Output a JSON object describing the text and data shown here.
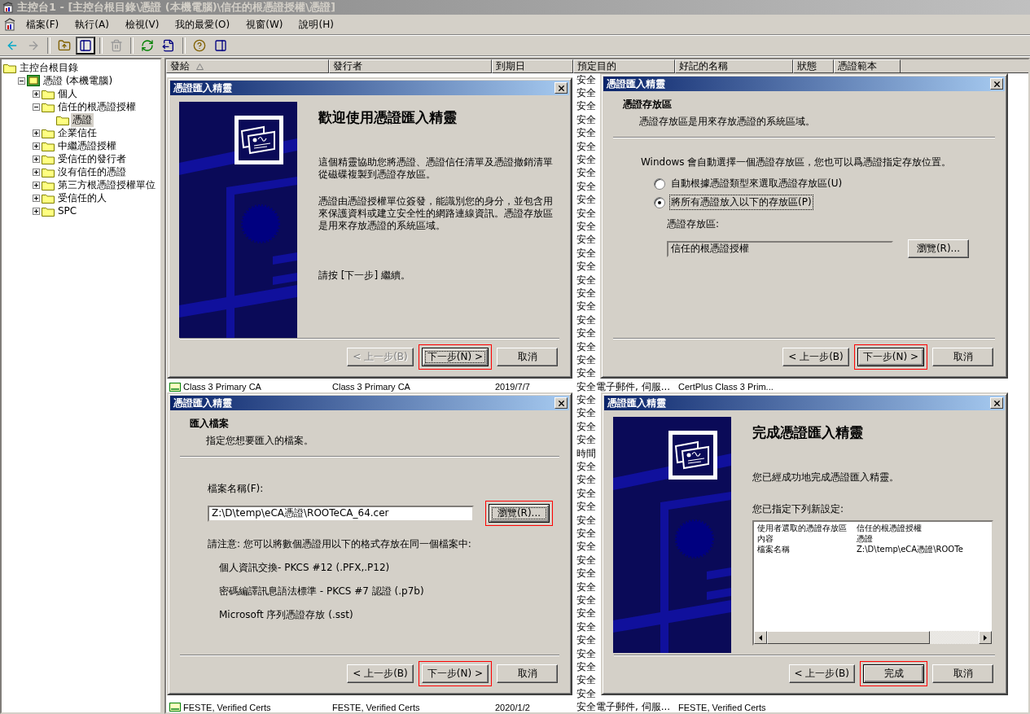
{
  "window": {
    "title": "主控台1 - [主控台根目錄\\憑證 (本機電腦)\\信任的根憑證授權\\憑證]"
  },
  "menu": [
    "檔案(F)",
    "執行(A)",
    "檢視(V)",
    "我的最愛(O)",
    "視窗(W)",
    "說明(H)"
  ],
  "toolbar": [
    {
      "kind": "back",
      "disabled": false
    },
    {
      "kind": "forward",
      "disabled": true
    },
    {
      "kind": "separator"
    },
    {
      "kind": "up",
      "disabled": false
    },
    {
      "kind": "tree",
      "disabled": false,
      "pressed": true
    },
    {
      "kind": "separator"
    },
    {
      "kind": "delete",
      "disabled": true
    },
    {
      "kind": "separator"
    },
    {
      "kind": "refresh",
      "disabled": false
    },
    {
      "kind": "export",
      "disabled": false
    },
    {
      "kind": "separator"
    },
    {
      "kind": "help",
      "disabled": false
    },
    {
      "kind": "panel",
      "disabled": false
    }
  ],
  "tree": {
    "label": "主控台根目錄",
    "kind": "root",
    "selected": false,
    "children": [
      {
        "label": "憑證 (本機電腦)",
        "kind": "store",
        "expanded": true,
        "selected": false,
        "children": [
          {
            "label": "個人",
            "kind": "folder",
            "expanded": false,
            "selected": false
          },
          {
            "label": "信任的根憑證授權",
            "kind": "folder",
            "expanded": true,
            "selected": false,
            "children": [
              {
                "label": "憑證",
                "kind": "folder",
                "selected": true
              }
            ]
          },
          {
            "label": "企業信任",
            "kind": "folder",
            "expanded": false,
            "selected": false
          },
          {
            "label": "中繼憑證授權",
            "kind": "folder",
            "expanded": false,
            "selected": false
          },
          {
            "label": "受信任的發行者",
            "kind": "folder",
            "expanded": false,
            "selected": false
          },
          {
            "label": "沒有信任的憑證",
            "kind": "folder",
            "expanded": false,
            "selected": false
          },
          {
            "label": "第三方根憑證授權單位",
            "kind": "folder",
            "expanded": false,
            "selected": false
          },
          {
            "label": "受信任的人",
            "kind": "folder",
            "expanded": false,
            "selected": false
          },
          {
            "label": "SPC",
            "kind": "folder",
            "expanded": false,
            "selected": false
          }
        ]
      }
    ]
  },
  "list": {
    "columns": [
      {
        "label": "發給",
        "sorted": true
      },
      {
        "label": "發行者",
        "sorted": false
      },
      {
        "label": "到期日",
        "sorted": false
      },
      {
        "label": "預定目的",
        "sorted": false
      },
      {
        "label": "好記的名稱",
        "sorted": false
      },
      {
        "label": "狀態",
        "sorted": false
      },
      {
        "label": "憑證範本",
        "sorted": false
      }
    ],
    "rows": [
      {
        "purpose": "安全"
      },
      {
        "purpose": "安全"
      },
      {
        "purpose": "安全"
      },
      {
        "purpose": "安全"
      },
      {
        "purpose": "安全"
      },
      {
        "purpose": "安全"
      },
      {
        "purpose": "安全"
      },
      {
        "purpose": "安全"
      },
      {
        "purpose": "安全"
      },
      {
        "purpose": "安全"
      },
      {
        "purpose": "安全"
      },
      {
        "purpose": "安全"
      },
      {
        "purpose": "安全"
      },
      {
        "purpose": "安全"
      },
      {
        "purpose": "安全"
      },
      {
        "purpose": "安全"
      },
      {
        "purpose": "安全"
      },
      {
        "purpose": "安全"
      },
      {
        "purpose": "安全"
      },
      {
        "purpose": "安全"
      },
      {
        "purpose": "安全"
      },
      {
        "purpose": "安全"
      },
      {
        "purpose": "安全"
      },
      {
        "issued_to": "Class 3 Primary CA",
        "issuer": "Class 3 Primary CA",
        "expiry": "2019/7/7",
        "purpose": "安全電子郵件, 伺服...",
        "friendly_name": "CertPlus Class 3 Prim..."
      },
      {
        "purpose": "安全"
      },
      {
        "purpose": "安全"
      },
      {
        "purpose": "安全"
      },
      {
        "purpose": "安全"
      },
      {
        "purpose": "時間"
      },
      {
        "purpose": "安全"
      },
      {
        "purpose": "安全"
      },
      {
        "purpose": "安全"
      },
      {
        "purpose": "安全"
      },
      {
        "purpose": "安全"
      },
      {
        "purpose": "安全"
      },
      {
        "purpose": "安全"
      },
      {
        "purpose": "安全"
      },
      {
        "purpose": "安全"
      },
      {
        "purpose": "安全"
      },
      {
        "purpose": "安全"
      },
      {
        "purpose": "安全"
      },
      {
        "purpose": "安全"
      },
      {
        "purpose": "安全"
      },
      {
        "purpose": "安全"
      },
      {
        "purpose": "安全"
      },
      {
        "purpose": "安全"
      },
      {
        "purpose": "安全"
      },
      {
        "issued_to": "FESTE, Verified Certs",
        "issuer": "FESTE, Verified Certs",
        "expiry": "2020/1/2",
        "purpose": "安全電子郵件, 伺服...",
        "friendly_name": "FESTE, Verified Certs"
      }
    ]
  },
  "dialogs": [
    {
      "kind": "welcome",
      "title": "憑證匯入精靈",
      "heading": "歡迎使用憑證匯入精靈",
      "paragraphs": [
        "這個精靈協助您將憑證、憑證信任清單及憑證撤銷清單從磁碟複製到憑證存放區。",
        "憑證由憑證授權單位簽發，能識別您的身分，並包含用來保護資料或建立安全性的網路連線資訊。憑證存放區是用來存放憑證的系統區域。",
        "請按 [下一步] 繼續。"
      ],
      "buttons": [
        {
          "label": "< 上一步(B)",
          "disabled": true,
          "default": false,
          "highlighted": false
        },
        {
          "label": "下一步(N) >",
          "disabled": false,
          "default": true,
          "highlighted": true
        },
        {
          "label": "取消",
          "disabled": false,
          "default": false,
          "highlighted": false
        }
      ]
    },
    {
      "kind": "store",
      "title": "憑證匯入精靈",
      "heading": "憑證存放區",
      "subheading": "憑證存放區是用來存放憑證的系統區域。",
      "intro": "Windows 會自動選擇一個憑證存放區，您也可以爲憑證指定存放位置。",
      "options": [
        {
          "label": "自動根據憑證類型來選取憑證存放區(U)",
          "selected": false,
          "focused": false
        },
        {
          "label": "將所有憑證放入以下的存放區(P)",
          "selected": true,
          "focused": true
        }
      ],
      "field": {
        "label": "憑證存放區:",
        "value": "信任的根憑證授權",
        "disabled": true
      },
      "browse": {
        "label": "瀏覽(R)...",
        "default": false,
        "highlighted": false
      },
      "buttons": [
        {
          "label": "< 上一步(B)",
          "disabled": false,
          "default": false,
          "highlighted": false
        },
        {
          "label": "下一步(N) >",
          "disabled": false,
          "default": true,
          "highlighted": true
        },
        {
          "label": "取消",
          "disabled": false,
          "default": false,
          "highlighted": false
        }
      ]
    },
    {
      "kind": "file",
      "title": "憑證匯入精靈",
      "heading": "匯入檔案",
      "subheading": "指定您想要匯入的檔案。",
      "field": {
        "label": "檔案名稱(F):",
        "value": "Z:\\D\\temp\\eCA憑證\\ROOTeCA_64.cer",
        "disabled": false
      },
      "browse": {
        "label": "瀏覽(R)...",
        "default": true,
        "highlighted": true
      },
      "note": "請注意: 您可以將數個憑證用以下的格式存放在同一個檔案中:",
      "formats": [
        "個人資訊交換- PKCS #12 (.PFX,.P12)",
        "密碼編譯訊息語法標準 - PKCS #7 認證 (.p7b)",
        "Microsoft 序列憑證存放 (.sst)"
      ],
      "buttons": [
        {
          "label": "< 上一步(B)",
          "disabled": false,
          "default": false,
          "highlighted": false
        },
        {
          "label": "下一步(N) >",
          "disabled": false,
          "default": false,
          "highlighted": true
        },
        {
          "label": "取消",
          "disabled": false,
          "default": false,
          "highlighted": false
        }
      ]
    },
    {
      "kind": "finish",
      "title": "憑證匯入精靈",
      "heading": "完成憑證匯入精靈",
      "paragraphs": [
        "您已經成功地完成憑證匯入精靈。",
        "您已指定下列新設定:"
      ],
      "settings": [
        {
          "name": "使用者選取的憑證存放區",
          "value": "信任的根憑證授權"
        },
        {
          "name": "內容",
          "value": "憑證"
        },
        {
          "name": "檔案名稱",
          "value": "Z:\\D\\temp\\eCA憑證\\ROOTe"
        }
      ],
      "buttons": [
        {
          "label": "< 上一步(B)",
          "disabled": false,
          "default": false,
          "highlighted": false
        },
        {
          "label": "完成",
          "disabled": false,
          "default": true,
          "highlighted": true
        },
        {
          "label": "取消",
          "disabled": false,
          "default": false,
          "highlighted": false
        }
      ]
    }
  ]
}
